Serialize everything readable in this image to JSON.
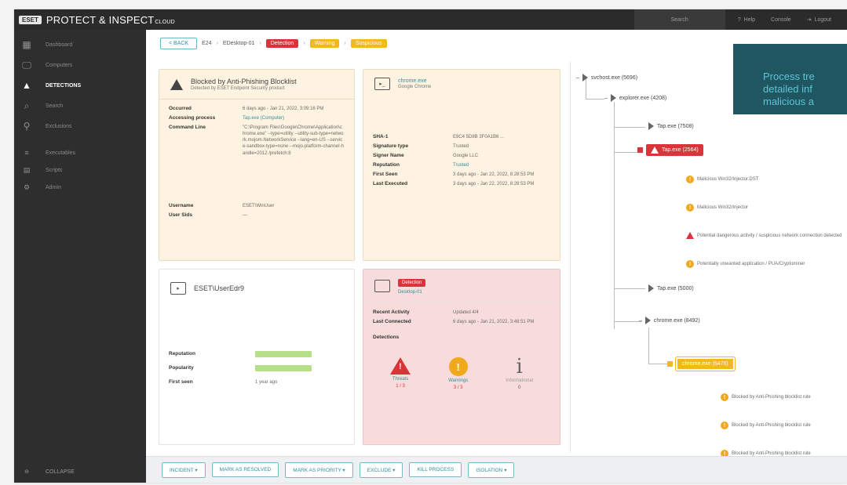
{
  "header": {
    "logo": "ESET",
    "product": "PROTECT & INSPECT",
    "product_suffix": "CLOUD",
    "search_placeholder": "Search",
    "items": [
      "Help",
      "Console",
      "Logout"
    ]
  },
  "sidebar": {
    "items": [
      {
        "label": "Dashboard",
        "icon": "dashboard-icon"
      },
      {
        "label": "Computers",
        "icon": "computers-icon"
      },
      {
        "label": "DETECTIONS",
        "icon": "detections-icon",
        "active": true
      },
      {
        "label": "Search",
        "icon": "search-icon"
      },
      {
        "label": "Exclusions",
        "icon": "exclusions-icon"
      },
      {
        "label": "Executables",
        "icon": "executables-icon"
      },
      {
        "label": "Scripts",
        "icon": "scripts-icon"
      },
      {
        "label": "Admin",
        "icon": "admin-icon"
      }
    ],
    "collapse_label": "COLLAPSE"
  },
  "breadcrumb": {
    "back": "< BACK",
    "items": [
      "E24",
      "EDesktop-01"
    ],
    "red_tag": "Detection",
    "yellow_tags": [
      "Warning",
      "Suspicious"
    ]
  },
  "detection_card": {
    "title": "Blocked by Anti-Phishing Blocklist",
    "subtitle": "Detected by ESET Endpoint Security product",
    "rows": [
      {
        "k": "Occurred",
        "v": "6 days ago - Jan 21, 2022, 3:09:16 PM"
      },
      {
        "k": "Accessing process",
        "v": "Tap.exe (Computer)",
        "link": true
      },
      {
        "k": "Command Line",
        "v": "\"C:\\Program Files\\Google\\Chrome\\Application\\chrome.exe\" --type=utility --utility-sub-type=network.mojom.NetworkService --lang=en-US --service-sandbox-type=none --mojo-platform-channel-handle=2012 /prefetch:8"
      },
      {
        "k": "Username",
        "v": "ESET\\WinUser"
      },
      {
        "k": "User Sids",
        "v": "—"
      }
    ]
  },
  "process_card": {
    "title": "chrome.exe",
    "subtitle": "Google Chrome",
    "rows": [
      {
        "k": "SHA-1",
        "v": "E9C4 5D8B 3F0A1B6 ..."
      },
      {
        "k": "Signature type",
        "v": "Trusted"
      },
      {
        "k": "Signer Name",
        "v": "Google LLC"
      },
      {
        "k": "Reputation",
        "v": "Trusted",
        "link": true
      },
      {
        "k": "First Seen",
        "v": "3 days ago - Jan 22, 2022, 8:28:53 PM"
      },
      {
        "k": "Last Executed",
        "v": "3 days ago - Jan 22, 2022, 8:28:53 PM"
      }
    ]
  },
  "user_card": {
    "title": "ESET\\UserEdr9",
    "rows": [
      {
        "k": "Reputation",
        "v": ""
      },
      {
        "k": "Popularity",
        "v": ""
      },
      {
        "k": "First seen",
        "v": "1 year ago"
      }
    ]
  },
  "computer_card": {
    "badge": "Detection",
    "computer_link": "Desktop-01",
    "rows": [
      {
        "k": "Recent Activity",
        "v": "Updated 4/4"
      },
      {
        "k": "Last Connected",
        "v": "6 days ago - Jan 21, 2022, 3:48:51 PM"
      }
    ],
    "detections_label": "Detections",
    "detections": [
      {
        "name": "Threats",
        "count": "1 / 3",
        "kind": "red"
      },
      {
        "name": "Warnings",
        "count": "3 / 3",
        "kind": "yellow"
      },
      {
        "name": "Informational",
        "count": "0",
        "kind": "info"
      }
    ]
  },
  "bottom_actions": [
    "INCIDENT",
    "MARK AS RESOLVED",
    "MARK AS PRIORITY",
    "EXCLUDE",
    "KILL PROCESS",
    "ISOLATION"
  ],
  "tree": {
    "root": "svchost.exe (5696)",
    "nodes": [
      {
        "label": "explorer.exe (4208)"
      },
      {
        "label": "Tap.exe (7508)"
      },
      {
        "label": "Tap.exe (2564)",
        "status": "red"
      },
      {
        "label": "Malicious Win32/Injector.DST",
        "detail": "yellow"
      },
      {
        "label": "Malicious Win32/Injector",
        "detail": "yellow"
      },
      {
        "label": "Potential dangerous activity / suspicious network connection detected",
        "detail": "red"
      },
      {
        "label": "Potentially unwanted application / PUA/Cryptominer",
        "detail": "yellow"
      },
      {
        "label": "Tap.exe (5000)"
      },
      {
        "label": "chrome.exe (8492)"
      },
      {
        "label": "chrome.exe (6476)",
        "status": "yellow"
      },
      {
        "label": "Blocked by Anti-Phishing blocklist rule",
        "detail": "yellow"
      },
      {
        "label": "Blocked by Anti-Phishing blocklist rule",
        "detail": "yellow"
      },
      {
        "label": "Blocked by Anti-Phishing blocklist rule",
        "detail": "yellow"
      }
    ]
  },
  "tooltip": {
    "lines": [
      "Process tre",
      "detailed inf",
      "malicious a"
    ]
  }
}
